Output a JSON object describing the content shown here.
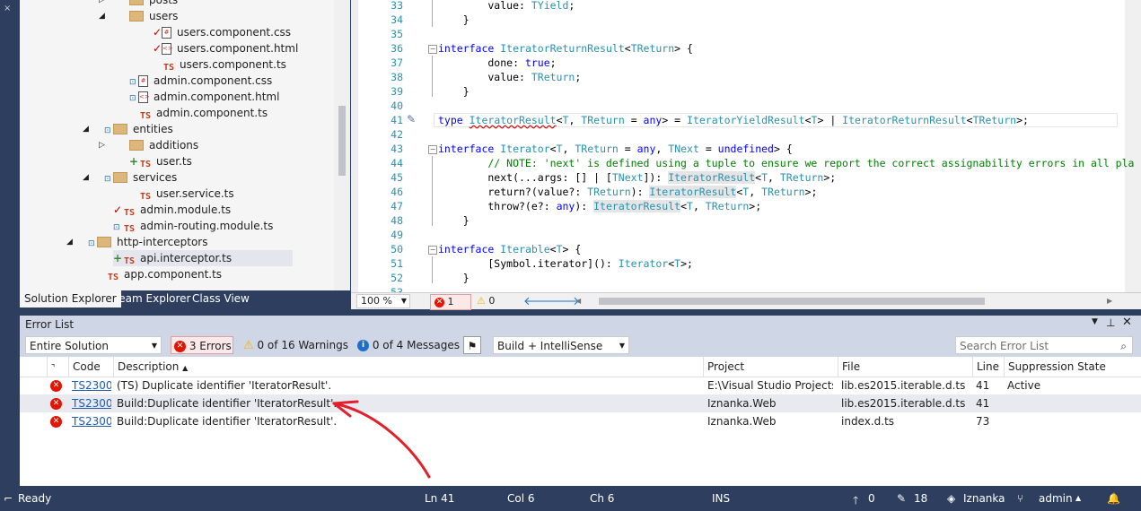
{
  "solution_explorer": {
    "tree": [
      {
        "label": "posts",
        "kind": "folder",
        "arrow": "▷"
      },
      {
        "label": "users",
        "kind": "folder",
        "arrow": "◢"
      },
      {
        "label": "users.component.css",
        "kind": "css",
        "mark": "✓"
      },
      {
        "label": "users.component.html",
        "kind": "html",
        "mark": "✓"
      },
      {
        "label": "users.component.ts",
        "kind": "ts"
      },
      {
        "label": "admin.component.css",
        "kind": "css",
        "mark": "🔒"
      },
      {
        "label": "admin.component.html",
        "kind": "html",
        "mark": "🔒"
      },
      {
        "label": "admin.component.ts",
        "kind": "ts"
      },
      {
        "label": "entities",
        "kind": "folder",
        "arrow": "◢",
        "mark": "🔒"
      },
      {
        "label": "additions",
        "kind": "folder",
        "arrow": "▷"
      },
      {
        "label": "user.ts",
        "kind": "ts",
        "mark": "+"
      },
      {
        "label": "services",
        "kind": "folder",
        "arrow": "◢",
        "mark": "🔒"
      },
      {
        "label": "user.service.ts",
        "kind": "ts"
      },
      {
        "label": "admin.module.ts",
        "kind": "ts",
        "mark": "✓"
      },
      {
        "label": "admin-routing.module.ts",
        "kind": "ts",
        "mark": "🔒"
      },
      {
        "label": "http-interceptors",
        "kind": "folder",
        "arrow": "◢",
        "mark": "🔒"
      },
      {
        "label": "api.interceptor.ts",
        "kind": "ts",
        "mark": "+"
      },
      {
        "label": "app.component.ts",
        "kind": "ts"
      }
    ],
    "tabs": [
      "Solution Explorer",
      "Team Explorer",
      "Class View"
    ]
  },
  "editor": {
    "zoom": "100 %",
    "error_count": "1",
    "warning_count": "0",
    "lines": [
      {
        "n": "33",
        "tokens": [
          [
            "",
            "        value: "
          ],
          [
            "ty",
            "TYield"
          ],
          [
            "",
            ";"
          ]
        ]
      },
      {
        "n": "34",
        "tokens": [
          [
            "",
            "    }"
          ]
        ]
      },
      {
        "n": "35",
        "tokens": []
      },
      {
        "n": "36",
        "tokens": [
          [
            "kw",
            "interface "
          ],
          [
            "ty",
            "IteratorReturnResult"
          ],
          [
            "",
            "<"
          ],
          [
            "ty",
            "TReturn"
          ],
          [
            "",
            "> {"
          ]
        ]
      },
      {
        "n": "37",
        "tokens": [
          [
            "",
            "        done: "
          ],
          [
            "kw",
            "true"
          ],
          [
            "",
            ";"
          ]
        ]
      },
      {
        "n": "38",
        "tokens": [
          [
            "",
            "        value: "
          ],
          [
            "ty",
            "TReturn"
          ],
          [
            "",
            ";"
          ]
        ]
      },
      {
        "n": "39",
        "tokens": [
          [
            "",
            "    }"
          ]
        ]
      },
      {
        "n": "40",
        "tokens": []
      },
      {
        "n": "41",
        "tokens": [
          [
            "kw",
            "type "
          ],
          [
            "ug ty",
            "IteratorResult"
          ],
          [
            "",
            "<"
          ],
          [
            "ty",
            "T"
          ],
          [
            "",
            ", "
          ],
          [
            "ty",
            "TReturn"
          ],
          [
            "",
            " = "
          ],
          [
            "kw",
            "any"
          ],
          [
            "",
            "> = "
          ],
          [
            "ty",
            "IteratorYieldResult"
          ],
          [
            "",
            "<"
          ],
          [
            "ty",
            "T"
          ],
          [
            "",
            "> | "
          ],
          [
            "ty",
            "IteratorReturnResult"
          ],
          [
            "",
            "<"
          ],
          [
            "ty",
            "TReturn"
          ],
          [
            "",
            ">;"
          ]
        ]
      },
      {
        "n": "42",
        "tokens": []
      },
      {
        "n": "43",
        "tokens": [
          [
            "kw",
            "interface "
          ],
          [
            "ty",
            "Iterator"
          ],
          [
            "",
            "<"
          ],
          [
            "ty",
            "T"
          ],
          [
            "",
            ", "
          ],
          [
            "ty",
            "TReturn"
          ],
          [
            "",
            " = "
          ],
          [
            "kw",
            "any"
          ],
          [
            "",
            ", "
          ],
          [
            "ty",
            "TNext"
          ],
          [
            "",
            " = "
          ],
          [
            "kw",
            "undefined"
          ],
          [
            "",
            "> {"
          ]
        ]
      },
      {
        "n": "44",
        "tokens": [
          [
            "cm",
            "        // NOTE: 'next' is defined using a tuple to ensure we report the correct assignability errors in all pla"
          ]
        ]
      },
      {
        "n": "45",
        "tokens": [
          [
            "",
            "        next(...args: [] | ["
          ],
          [
            "ty",
            "TNext"
          ],
          [
            "",
            "]): "
          ],
          [
            "hl ty",
            "IteratorResult"
          ],
          [
            "",
            "<"
          ],
          [
            "ty",
            "T"
          ],
          [
            "",
            ", "
          ],
          [
            "ty",
            "TReturn"
          ],
          [
            "",
            ">;"
          ]
        ]
      },
      {
        "n": "46",
        "tokens": [
          [
            "",
            "        return?(value?: "
          ],
          [
            "ty",
            "TReturn"
          ],
          [
            "",
            "): "
          ],
          [
            "hl ty",
            "IteratorResult"
          ],
          [
            "",
            "<"
          ],
          [
            "ty",
            "T"
          ],
          [
            "",
            ", "
          ],
          [
            "ty",
            "TReturn"
          ],
          [
            "",
            ">;"
          ]
        ]
      },
      {
        "n": "47",
        "tokens": [
          [
            "",
            "        throw?(e?: "
          ],
          [
            "kw",
            "any"
          ],
          [
            "",
            "): "
          ],
          [
            "hl ty",
            "IteratorResult"
          ],
          [
            "",
            "<"
          ],
          [
            "ty",
            "T"
          ],
          [
            "",
            ", "
          ],
          [
            "ty",
            "TReturn"
          ],
          [
            "",
            ">;"
          ]
        ]
      },
      {
        "n": "48",
        "tokens": [
          [
            "",
            "    }"
          ]
        ]
      },
      {
        "n": "49",
        "tokens": []
      },
      {
        "n": "50",
        "tokens": [
          [
            "kw",
            "interface "
          ],
          [
            "ty",
            "Iterable"
          ],
          [
            "",
            "<"
          ],
          [
            "ty",
            "T"
          ],
          [
            "",
            "> {"
          ]
        ]
      },
      {
        "n": "51",
        "tokens": [
          [
            "",
            "        [Symbol.iterator](): "
          ],
          [
            "ty",
            "Iterator"
          ],
          [
            "",
            "<"
          ],
          [
            "ty",
            "T"
          ],
          [
            "",
            ">;"
          ]
        ]
      },
      {
        "n": "52",
        "tokens": [
          [
            "",
            "    }"
          ]
        ]
      },
      {
        "n": "53",
        "tokens": []
      }
    ]
  },
  "error_list": {
    "title": "Error List",
    "scope": "Entire Solution",
    "errors_btn": "3 Errors",
    "warnings_btn": "0 of 16 Warnings",
    "messages_btn": "0 of 4 Messages",
    "build_filter": "Build + IntelliSense",
    "search_placeholder": "Search Error List",
    "columns": [
      "Code",
      "Description",
      "Project",
      "File",
      "Line",
      "Suppression State"
    ],
    "rows": [
      {
        "code": "TS2300",
        "description": "(TS) Duplicate identifier 'IteratorResult'.",
        "project": "E:\\Visual Studio Projects\\I...",
        "file": "lib.es2015.iterable.d.ts",
        "line": "41",
        "state": "Active"
      },
      {
        "code": "TS2300",
        "description": "Build:Duplicate identifier 'IteratorResult'.",
        "project": "Iznanka.Web",
        "file": "lib.es2015.iterable.d.ts",
        "line": "41",
        "state": ""
      },
      {
        "code": "TS2300",
        "description": "Build:Duplicate identifier 'IteratorResult'.",
        "project": "Iznanka.Web",
        "file": "index.d.ts",
        "line": "73",
        "state": ""
      }
    ]
  },
  "status": {
    "ready": "Ready",
    "ln": "Ln 41",
    "col": "Col 6",
    "ch": "Ch 6",
    "ins": "INS",
    "up": "0",
    "pencil": "18",
    "repo": "Iznanka",
    "branch": "admin"
  },
  "colors": {
    "error": "#e51400",
    "warning": "#f0b400",
    "accent": "#2d3e5e",
    "annotation": "#e0202a"
  }
}
